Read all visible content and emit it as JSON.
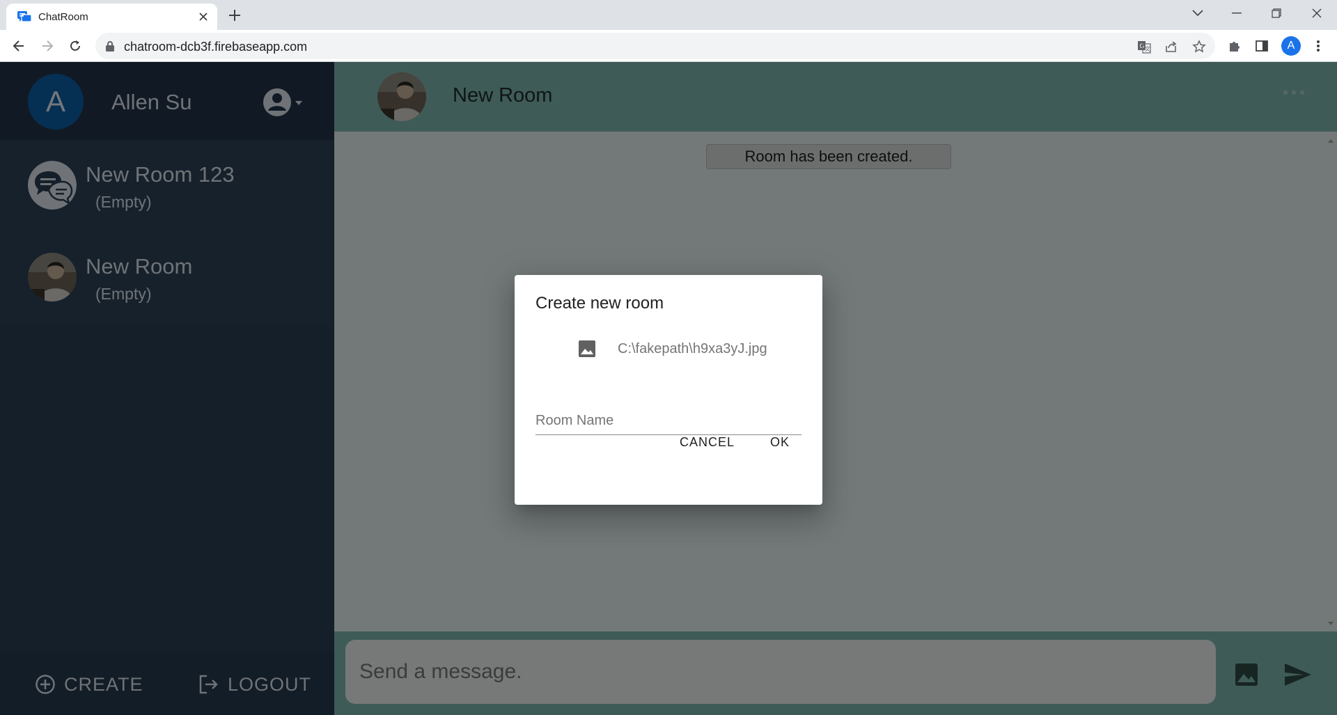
{
  "browser": {
    "tab_title": "ChatRoom",
    "url": "chatroom-dcb3f.firebaseapp.com",
    "profile_initial": "A",
    "accent_color": "#1a73e8"
  },
  "sidebar": {
    "user": {
      "initial": "A",
      "name": "Allen Su"
    },
    "rooms": [
      {
        "name": "New Room 123",
        "last_message": "(Empty)",
        "icon": "chat-bubbles-icon"
      },
      {
        "name": "New Room",
        "last_message": "(Empty)",
        "icon": "room-photo"
      }
    ],
    "footer": {
      "create_label": "CREATE",
      "logout_label": "LOGOUT"
    }
  },
  "chat": {
    "title": "New Room",
    "system_message": "Room has been created.",
    "composer_placeholder": "Send a message."
  },
  "dialog": {
    "title": "Create new room",
    "file_name": "C:\\fakepath\\h9xa3yJ.jpg",
    "room_name_placeholder": "Room Name",
    "room_name_value": "",
    "cancel_label": "CANCEL",
    "ok_label": "OK"
  },
  "colors": {
    "sidebar_bg": "#2a3f54",
    "header_accent": "#7fb7ae",
    "chat_bg": "#e4f2f0",
    "user_avatar": "#0d5ea8"
  }
}
